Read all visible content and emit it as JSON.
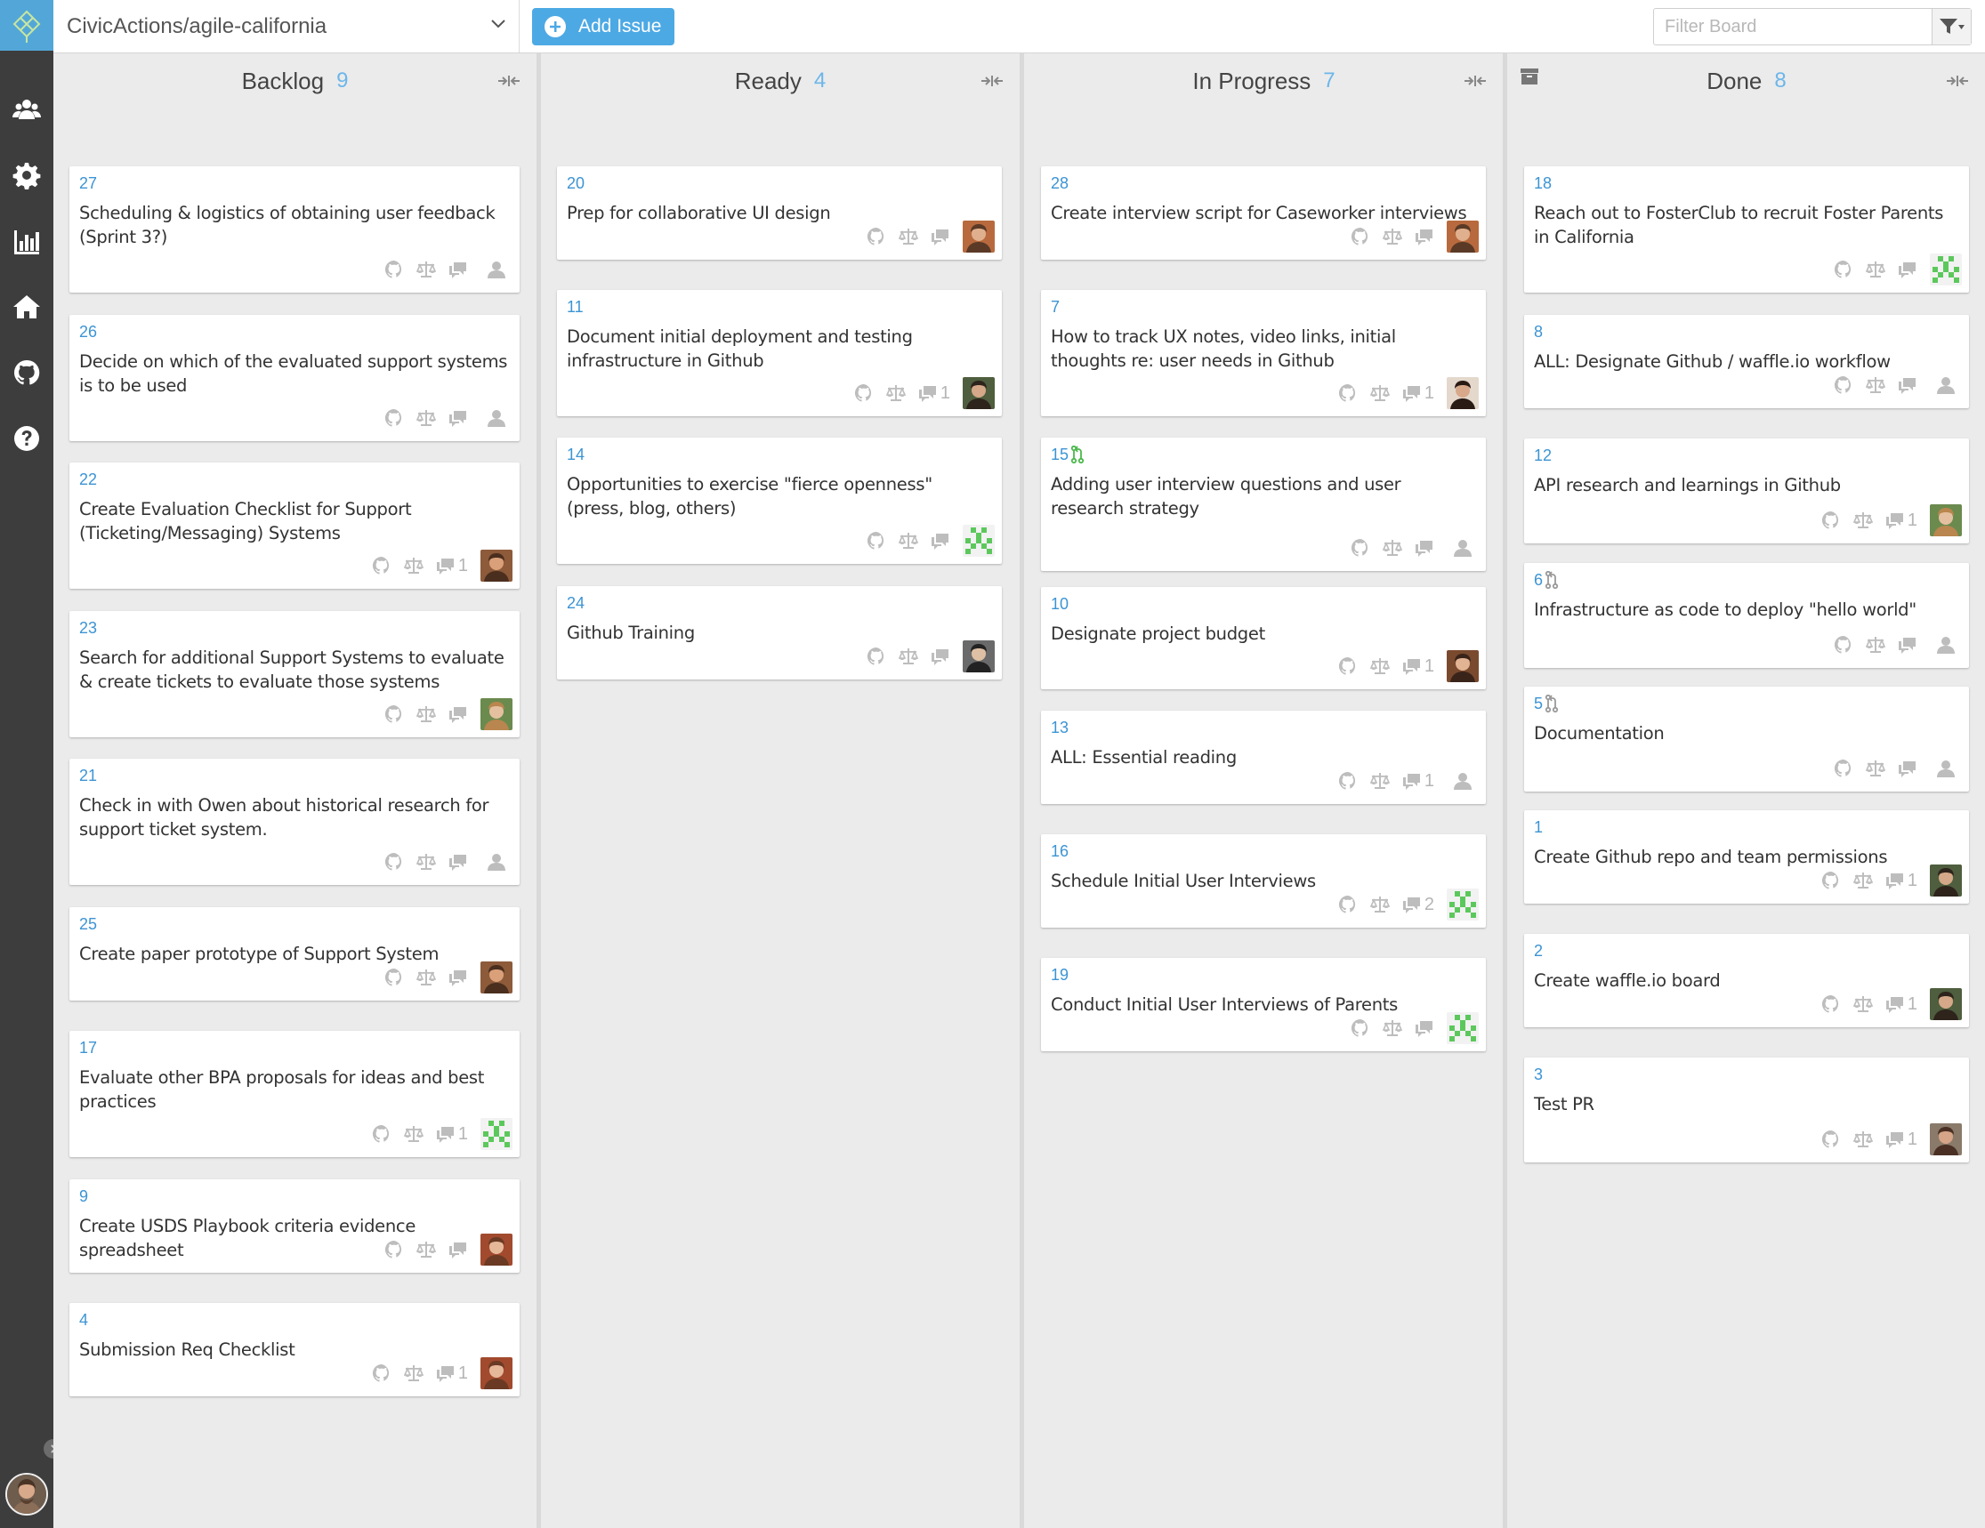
{
  "topbar": {
    "repo": "CivicActions/agile-california",
    "add_issue_label": "Add Issue",
    "filter_placeholder": "Filter Board"
  },
  "sidebar": {
    "items": [
      {
        "name": "team-icon"
      },
      {
        "name": "gear-icon"
      },
      {
        "name": "chart-icon"
      },
      {
        "name": "home-icon"
      },
      {
        "name": "github-icon"
      },
      {
        "name": "help-icon"
      }
    ]
  },
  "colors": {
    "sidebar": "#3d3d3d",
    "accent": "#4da9e4",
    "issue_number": "#3c94d4",
    "board_bg": "#ebebeb"
  },
  "columns": [
    {
      "title": "Backlog",
      "count": "9",
      "cards": [
        {
          "num": "27",
          "title": "Scheduling & logistics of obtaining user feedback (Sprint 3?)",
          "comments": "",
          "avatar": "none"
        },
        {
          "num": "26",
          "title": "Decide on which of the evaluated support systems is to be used",
          "comments": "",
          "avatar": "none"
        },
        {
          "num": "22",
          "title": "Create Evaluation Checklist for Support (Ticketing/Messaging) Systems",
          "comments": "1",
          "avatar": "a2"
        },
        {
          "num": "23",
          "title": "Search for additional Support Systems to evaluate & create tickets to evaluate those systems",
          "comments": "",
          "avatar": "a3"
        },
        {
          "num": "21",
          "title": "Check in with Owen about historical research for support ticket system.",
          "comments": "",
          "avatar": "none"
        },
        {
          "num": "25",
          "title": "Create paper prototype of Support System",
          "comments": "",
          "avatar": "a2"
        },
        {
          "num": "17",
          "title": "Evaluate other BPA proposals for ideas and best practices",
          "comments": "1",
          "avatar": "identicon"
        },
        {
          "num": "9",
          "title": "Create USDS Playbook criteria evidence spreadsheet",
          "comments": "",
          "avatar": "a5"
        },
        {
          "num": "4",
          "title": "Submission Req Checklist",
          "comments": "1",
          "avatar": "a5"
        }
      ]
    },
    {
      "title": "Ready",
      "count": "4",
      "cards": [
        {
          "num": "20",
          "title": "Prep for collaborative UI design",
          "comments": "",
          "avatar": "a1"
        },
        {
          "num": "11",
          "title": "Document initial deployment and testing infrastructure in Github",
          "comments": "1",
          "avatar": "a4"
        },
        {
          "num": "14",
          "title": "Opportunities to exercise \"fierce openness\" (press, blog, others)",
          "comments": "",
          "avatar": "identicon"
        },
        {
          "num": "24",
          "title": "Github Training",
          "comments": "",
          "avatar": "a6"
        }
      ]
    },
    {
      "title": "In Progress",
      "count": "7",
      "cards": [
        {
          "num": "28",
          "title": "Create interview script for Caseworker interviews",
          "comments": "",
          "avatar": "a1"
        },
        {
          "num": "7",
          "title": "How to track UX notes, video links, initial thoughts re: user needs in Github",
          "comments": "1",
          "avatar": "a7"
        },
        {
          "num": "15",
          "title": "Adding user interview questions and user research strategy",
          "comments": "",
          "avatar": "none",
          "pr": "green"
        },
        {
          "num": "10",
          "title": "Designate project budget",
          "comments": "1",
          "avatar": "a8"
        },
        {
          "num": "13",
          "title": "ALL: Essential reading",
          "comments": "1",
          "avatar": "none"
        },
        {
          "num": "16",
          "title": "Schedule Initial User Interviews",
          "comments": "2",
          "avatar": "identicon"
        },
        {
          "num": "19",
          "title": "Conduct Initial User Interviews of Parents",
          "comments": "",
          "avatar": "identicon"
        }
      ]
    },
    {
      "title": "Done",
      "count": "8",
      "cards": [
        {
          "num": "18",
          "title": "Reach out to FosterClub to recruit Foster Parents in California",
          "comments": "",
          "avatar": "identicon"
        },
        {
          "num": "8",
          "title": "ALL: Designate Github / waffle.io workflow",
          "comments": "",
          "avatar": "none"
        },
        {
          "num": "12",
          "title": "API research and learnings in Github",
          "comments": "1",
          "avatar": "a3"
        },
        {
          "num": "6",
          "title": "Infrastructure as code to deploy \"hello world\"",
          "comments": "",
          "avatar": "none",
          "pr": "gray"
        },
        {
          "num": "5",
          "title": "Documentation",
          "comments": "",
          "avatar": "none",
          "pr": "gray"
        },
        {
          "num": "1",
          "title": "Create Github repo and team permissions",
          "comments": "1",
          "avatar": "a4"
        },
        {
          "num": "2",
          "title": "Create waffle.io board",
          "comments": "1",
          "avatar": "a4"
        },
        {
          "num": "3",
          "title": "Test PR",
          "comments": "1",
          "avatar": "a9"
        }
      ]
    }
  ]
}
